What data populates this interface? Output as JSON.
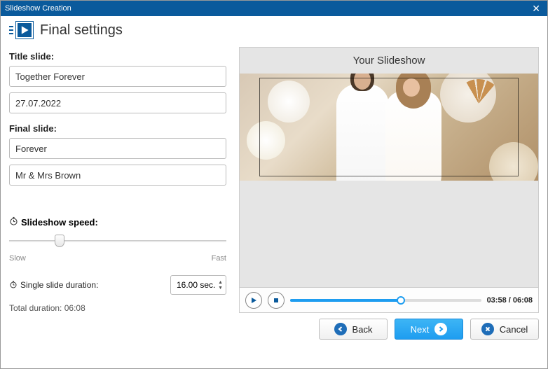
{
  "window": {
    "title": "Slideshow Creation"
  },
  "header": {
    "title": "Final settings"
  },
  "form": {
    "titleSlide": {
      "label": "Title slide:",
      "line1": "Together Forever",
      "line2": "27.07.2022"
    },
    "finalSlide": {
      "label": "Final slide:",
      "line1": "Forever",
      "line2": "Mr & Mrs Brown"
    },
    "speed": {
      "label": "Slideshow speed:",
      "slow": "Slow",
      "fast": "Fast"
    },
    "singleDuration": {
      "label": "Single slide duration:",
      "value": "16.00 sec."
    },
    "total": {
      "text": "Total duration: 06:08"
    }
  },
  "preview": {
    "title": "Your Slideshow",
    "time": "03:58 / 06:08"
  },
  "footer": {
    "back": "Back",
    "next": "Next",
    "cancel": "Cancel"
  }
}
